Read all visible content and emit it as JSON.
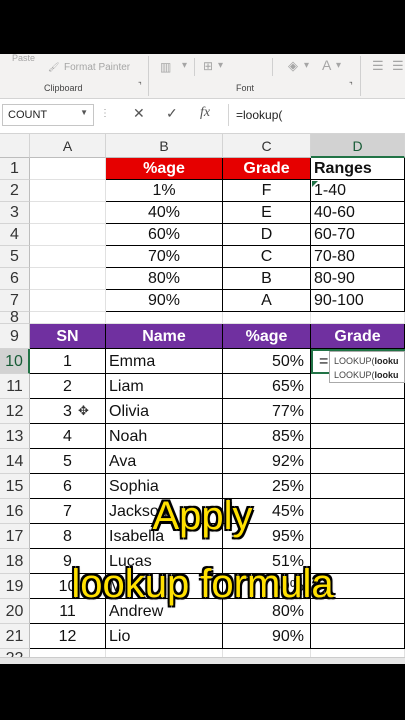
{
  "ribbon": {
    "paste_label": "Paste",
    "format_painter_label": "Format Painter",
    "clipboard_group": "Clipboard",
    "font_group": "Font",
    "launcher_glyph": "⌝"
  },
  "formula_bar": {
    "name_box": "COUNT",
    "cancel_icon": "✕",
    "enter_icon": "✓",
    "fx_label": "fx",
    "formula": "=lookup("
  },
  "columns": [
    "A",
    "B",
    "C",
    "D"
  ],
  "rows": [
    "1",
    "2",
    "3",
    "4",
    "5",
    "6",
    "7",
    "8",
    "9",
    "10",
    "11",
    "12",
    "13",
    "14",
    "15",
    "16",
    "17",
    "18",
    "19",
    "20",
    "21",
    "22"
  ],
  "grade_table": {
    "headers": [
      "%age",
      "Grade",
      "Ranges"
    ],
    "rows": [
      [
        "1%",
        "F",
        "1-40"
      ],
      [
        "40%",
        "E",
        "40-60"
      ],
      [
        "60%",
        "D",
        "60-70"
      ],
      [
        "70%",
        "C",
        "70-80"
      ],
      [
        "80%",
        "B",
        "80-90"
      ],
      [
        "90%",
        "A",
        "90-100"
      ]
    ]
  },
  "student_table": {
    "headers": [
      "SN",
      "Name",
      "%age",
      "Grade"
    ],
    "rows": [
      [
        "1",
        "Emma",
        "50%"
      ],
      [
        "2",
        "Liam",
        "65%"
      ],
      [
        "3",
        "Olivia",
        "77%"
      ],
      [
        "4",
        "Noah",
        "85%"
      ],
      [
        "5",
        "Ava",
        "92%"
      ],
      [
        "6",
        "Sophia",
        "25%"
      ],
      [
        "7",
        "Jackson",
        "45%"
      ],
      [
        "8",
        "Isabella",
        "95%"
      ],
      [
        "9",
        "Lucas",
        "51%"
      ],
      [
        "10",
        "Mia",
        "59%"
      ],
      [
        "11",
        "Andrew",
        "80%"
      ],
      [
        "12",
        "Lio",
        "90%"
      ]
    ],
    "active_cell_text": "=lookup("
  },
  "tooltip": {
    "line1_prefix": "LOOKUP(",
    "line1_bold": "looku",
    "line2_prefix": "LOOKUP(",
    "line2_bold": "looku"
  },
  "overlay": {
    "line1": "Apply",
    "line2": "lookup formula"
  },
  "colors": {
    "grade_header": "#e60000",
    "student_header": "#7030a0",
    "selection": "#217346",
    "overlay_text": "#ffe000"
  }
}
